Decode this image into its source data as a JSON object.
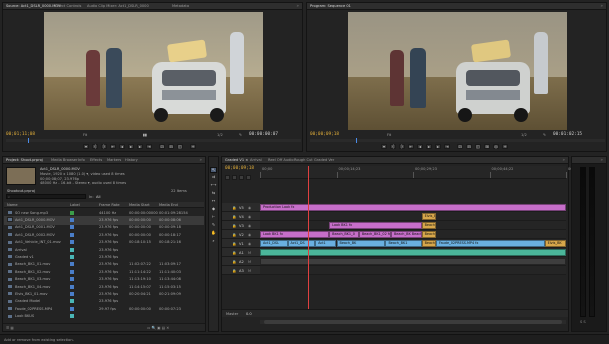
{
  "source_panel": {
    "tabs": [
      "Source: Act1_DSLR_0000.MOV",
      "Effect Controls",
      "Audio Clip Mixer: Act1_DSLR_0000",
      "Metadata"
    ],
    "timecode_left": "00;01;11;08",
    "fit": "Fit",
    "timecode_right": "00:00:00:07",
    "page_num": "1/2"
  },
  "program_panel": {
    "tabs": [
      "Program: Sequence 01"
    ],
    "timecode_left": "00;00;09;18",
    "fit": "Fit",
    "timecode_right": "00:01:02:15",
    "page_num": "1/2"
  },
  "project_panel": {
    "tabs": [
      "Project: Shoot.prproj",
      "Media Browser",
      "Info",
      "Effects",
      "Markers",
      "History"
    ],
    "clip_name": "Act1_DSLR_0000.MOV",
    "clip_info_1": "Movie, 1920 x 1080 (1.0) ▾, video used 8 times",
    "clip_info_2": "00;00;08;07, 23.976p",
    "clip_info_3": "48000 Hz - 16-bit - Stereo ▾, audio used 8 times",
    "project_name": "Shootout.prproj",
    "item_count": "22 Items",
    "in_label": "In:",
    "in_value": "All",
    "columns": [
      "Name",
      "Label",
      "Frame Rate",
      "Media Start",
      "Media End"
    ],
    "items": [
      {
        "name": "SO new Song.mp3",
        "color": "#3b9d4a",
        "rate": "44100 Hz",
        "start": "00:00:00:00000",
        "end": "00:01:09:28154"
      },
      {
        "name": "Act1_DSLR_0000.MOV",
        "color": "#4a7ec9",
        "rate": "23.976 fps",
        "start": "00:00:00:00",
        "end": "00:00:08:06"
      },
      {
        "name": "Act1_DSLR_0001.MOV",
        "color": "#4a7ec9",
        "rate": "23.976 fps",
        "start": "00:00:00:00",
        "end": "00:00:09:18"
      },
      {
        "name": "Act1_DSLR_0002.MOV",
        "color": "#4a7ec9",
        "rate": "23.976 fps",
        "start": "00:00:00:00",
        "end": "00:00:18:17"
      },
      {
        "name": "Act1_Vehicle_INT_01.mov",
        "color": "#4a7ec9",
        "rate": "23.976 fps",
        "start": "00:18:10:15",
        "end": "00:18:21:16"
      },
      {
        "name": "Arrival",
        "color": "#4ab6b6",
        "rate": "23.976 fps",
        "start": "",
        "end": ""
      },
      {
        "name": "Graded v1",
        "color": "#4ab6b6",
        "rate": "23.976 fps",
        "start": "",
        "end": ""
      },
      {
        "name": "Beach_BK1_01.mov",
        "color": "#4a7ec9",
        "rate": "23.976 fps",
        "start": "11:02:07:22",
        "end": "11:03:09:17"
      },
      {
        "name": "Beach_BK1_02.mov",
        "color": "#4a7ec9",
        "rate": "23.976 fps",
        "start": "11:11:14:22",
        "end": "11:11:40:03"
      },
      {
        "name": "Beach_BK1_03.mov",
        "color": "#4a7ec9",
        "rate": "23.976 fps",
        "start": "11:13:19:10",
        "end": "11:13:44:08"
      },
      {
        "name": "Beach_BK1_04.mov",
        "color": "#4a7ec9",
        "rate": "23.976 fps",
        "start": "11:14:15:07",
        "end": "11:15:03:15"
      },
      {
        "name": "Elvis_BK1_01.mov",
        "color": "#4a7ec9",
        "rate": "23.976 fps",
        "start": "00:20:04:21",
        "end": "00:21:09:09"
      },
      {
        "name": "Graded Model",
        "color": "#4ab6b6",
        "rate": "23.976 fps",
        "start": "",
        "end": ""
      },
      {
        "name": "Faude_02PRESS.MP4",
        "color": "#4a7ec9",
        "rate": "29.97 fps",
        "start": "00:00:00:00",
        "end": "00:00:07:23"
      },
      {
        "name": "Look BKUS",
        "color": "#4ab6b6",
        "rate": "",
        "start": "",
        "end": ""
      }
    ]
  },
  "timeline": {
    "tab": "Graded V1 ×",
    "tabs_other": [
      "Arrival",
      "Reel Off Audio",
      "Rough Cut",
      "Graded Ver"
    ],
    "timecode": "00;00;09;18",
    "ruler_labels": [
      "00;00",
      "00;00;14;23",
      "00;00;29;23",
      "00;00;44;22",
      "00;00;59;22"
    ],
    "tracks": [
      {
        "id": "V5",
        "kind": "video"
      },
      {
        "id": "V4",
        "kind": "video"
      },
      {
        "id": "V3",
        "kind": "video"
      },
      {
        "id": "V2",
        "kind": "video"
      },
      {
        "id": "V1",
        "kind": "video"
      },
      {
        "id": "A1",
        "kind": "audio"
      },
      {
        "id": "A2",
        "kind": "audio"
      },
      {
        "id": "A3",
        "kind": "audio"
      }
    ],
    "master_label": "Master",
    "master_value": "0.0",
    "clips": [
      {
        "label": "Production Look fx",
        "color": "#c66ec9",
        "track": 0,
        "start": 0.0,
        "end": 0.999
      },
      {
        "label": "Elvis_B",
        "color": "#d7a74b",
        "track": 1,
        "start": 0.528,
        "end": 0.575
      },
      {
        "label": "Beach_B",
        "color": "#d7a74b",
        "track": 2,
        "start": 0.528,
        "end": 0.575
      },
      {
        "label": "Look BK1 fx",
        "color": "#c66ec9",
        "track": 2,
        "start": 0.226,
        "end": 0.528
      },
      {
        "label": "Look BK1 fx",
        "color": "#c66ec9",
        "track": 3,
        "start": 0.0,
        "end": 0.226
      },
      {
        "label": "Beach_BK1_0",
        "color": "#c66ec9",
        "track": 3,
        "start": 0.226,
        "end": 0.323
      },
      {
        "label": "Beach_BK1_02 fx",
        "color": "#c66ec9",
        "track": 3,
        "start": 0.323,
        "end": 0.428
      },
      {
        "label": "Beach_BK Beach_fx",
        "color": "#c66ec9",
        "track": 3,
        "start": 0.428,
        "end": 0.528
      },
      {
        "label": "Beach_B",
        "color": "#d7a74b",
        "track": 3,
        "start": 0.528,
        "end": 0.575
      },
      {
        "label": "Act1_DSL",
        "color": "#6ab0e0",
        "track": 4,
        "start": 0.0,
        "end": 0.09
      },
      {
        "label": "Act1_DS",
        "color": "#6ab0e0",
        "track": 4,
        "start": 0.09,
        "end": 0.18
      },
      {
        "label": "Act1",
        "color": "#6ab0e0",
        "track": 4,
        "start": 0.18,
        "end": 0.25
      },
      {
        "label": "Beach_BK",
        "color": "#6ab0e0",
        "track": 4,
        "start": 0.25,
        "end": 0.41
      },
      {
        "label": "Beach_BK1",
        "color": "#6ab0e0",
        "track": 4,
        "start": 0.41,
        "end": 0.528
      },
      {
        "label": "Beach_B",
        "color": "#d7a74b",
        "track": 4,
        "start": 0.528,
        "end": 0.575
      },
      {
        "label": "Faude_02PRESS.MP4 fx",
        "color": "#6ab0e0",
        "track": 4,
        "start": 0.575,
        "end": 0.93
      },
      {
        "label": "Elvis_BK",
        "color": "#d7a74b",
        "track": 4,
        "start": 0.93,
        "end": 0.999
      },
      {
        "label": "",
        "color": "#4bb69a",
        "track": 5,
        "start": 0.0,
        "end": 0.999
      },
      {
        "label": "",
        "color": "#3e3e3e",
        "track": 6,
        "start": 0.0,
        "end": 0.999
      }
    ],
    "playhead_fraction": 0.157
  },
  "status_bar": {
    "text": "Add or remove from existing selection."
  },
  "icons": {
    "play": "play-icon",
    "step_back": "step-back-icon",
    "step_fwd": "step-forward-icon",
    "mark_in": "mark-in-icon",
    "mark_out": "mark-out-icon",
    "wrench": "wrench-icon",
    "selection": "selection-tool-icon",
    "razor": "razor-tool-icon",
    "hand": "hand-tool-icon",
    "zoom": "zoom-tool-icon"
  }
}
